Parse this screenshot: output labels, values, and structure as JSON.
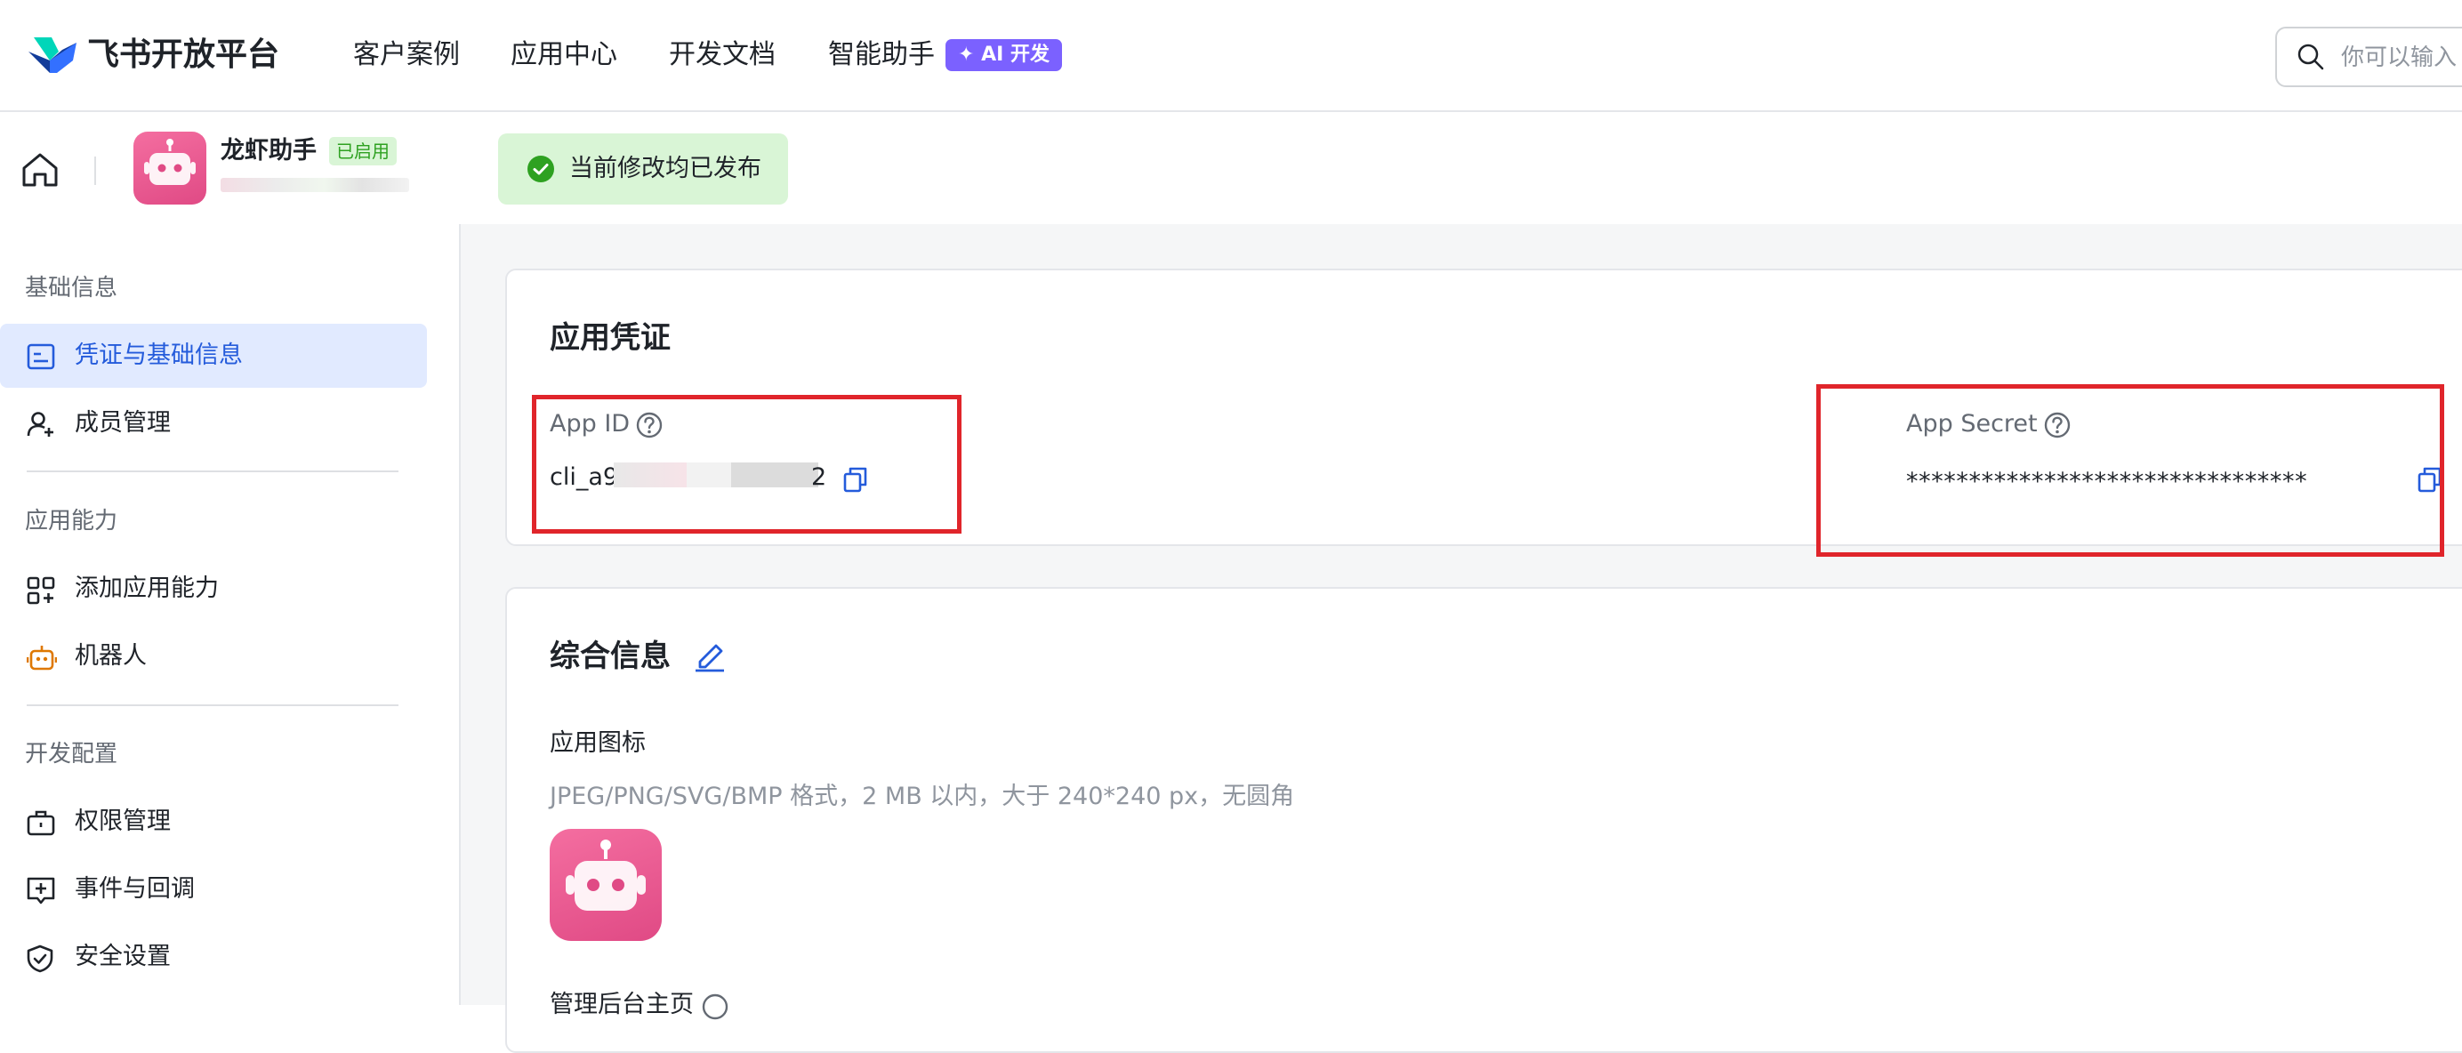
{
  "topnav": {
    "brand": "飞书开放平台",
    "links": [
      "客户案例",
      "应用中心",
      "开发文档",
      "智能助手"
    ],
    "ai_badge": "AI 开发",
    "search_placeholder": "你可以输入"
  },
  "app_header": {
    "app_name": "龙虾助手",
    "status": "已启用",
    "publish_status": "当前修改均已发布"
  },
  "sidebar": {
    "groups": [
      {
        "title": "基础信息",
        "items": [
          {
            "label": "凭证与基础信息",
            "icon": "id-card-icon",
            "active": true
          },
          {
            "label": "成员管理",
            "icon": "user-add-icon",
            "active": false
          }
        ]
      },
      {
        "title": "应用能力",
        "items": [
          {
            "label": "添加应用能力",
            "icon": "grid-add-icon",
            "active": false
          },
          {
            "label": "机器人",
            "icon": "robot-icon",
            "active": false
          }
        ]
      },
      {
        "title": "开发配置",
        "items": [
          {
            "label": "权限管理",
            "icon": "briefcase-icon",
            "active": false
          },
          {
            "label": "事件与回调",
            "icon": "event-add-icon",
            "active": false
          },
          {
            "label": "安全设置",
            "icon": "shield-icon",
            "active": false
          }
        ]
      }
    ]
  },
  "credentials": {
    "title": "应用凭证",
    "app_id_label": "App ID",
    "app_id_value_start": "cli_a9",
    "app_id_value_end": "2",
    "app_secret_label": "App Secret",
    "app_secret_value": "********************************"
  },
  "general_info": {
    "title": "综合信息",
    "icon_label": "应用图标",
    "icon_hint": "JPEG/PNG/SVG/BMP 格式，2 MB 以内，大于 240*240 px，无圆角",
    "admin_home_label": "管理后台主页"
  },
  "colors": {
    "accent": "#245bdb",
    "active_bg": "#e1eaff",
    "success_bg": "#d9f5d6",
    "success": "#2ea121",
    "highlight_box": "#e0252b",
    "ai_badge": "#7b61ff",
    "app_icon": "#e94d8a"
  }
}
